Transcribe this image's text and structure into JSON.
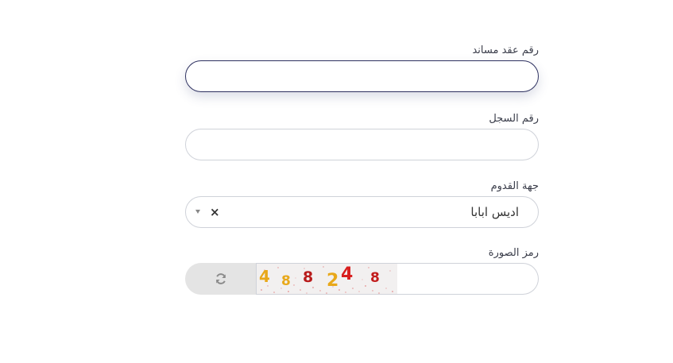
{
  "form": {
    "contract_number": {
      "label": "رقم عقد مساند",
      "value": ""
    },
    "record_number": {
      "label": "رقم السجل",
      "value": ""
    },
    "arrival_origin": {
      "label": "جهة القدوم",
      "selected": "اديس ابابا",
      "clear_symbol": "×"
    },
    "captcha": {
      "label": "رمز الصورة",
      "value": "",
      "image_text": "488248",
      "refresh_icon": "refresh-icon"
    }
  },
  "colors": {
    "focus_border": "#2e3160",
    "field_border": "#cfd2d9",
    "refresh_bg": "#e4e4e4",
    "captcha_digits": [
      "#e8a81a",
      "#e8a81a",
      "#b81c1c",
      "#e8a81a",
      "#d81e1e",
      "#c21c1c"
    ]
  }
}
